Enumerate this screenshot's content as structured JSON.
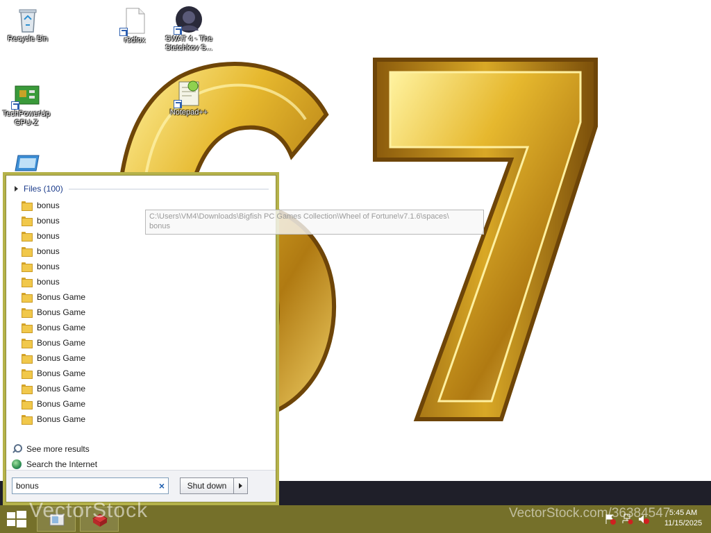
{
  "desktop": {
    "icons": [
      {
        "label": "Recycle Bin",
        "icon": "recycle-bin-icon"
      },
      {
        "label": "r3dfox",
        "icon": "file-shortcut-icon"
      },
      {
        "label": "SWAT 4 - The Stetchkov S...",
        "icon": "swat4-game-icon"
      },
      {
        "label": "TechPowerUp GPU-Z",
        "icon": "gpu-z-icon"
      },
      {
        "label": "Notepad++",
        "icon": "notepad-plus-plus-icon"
      }
    ],
    "wallpaper_text": "67"
  },
  "start_menu": {
    "group_header": "Files (100)",
    "results": [
      "bonus",
      "bonus",
      "bonus",
      "bonus",
      "bonus",
      "bonus",
      "Bonus Game",
      "Bonus Game",
      "Bonus Game",
      "Bonus Game",
      "Bonus Game",
      "Bonus Game",
      "Bonus Game",
      "Bonus Game",
      "Bonus Game"
    ],
    "see_more": "See more results",
    "search_internet": "Search the Internet",
    "search_value": "bonus",
    "shutdown_label": "Shut down"
  },
  "tooltip": {
    "line1": "C:\\Users\\VM4\\Downloads\\Bigfish PC Games Collection\\Wheel of Fortune\\v7.1.6\\spaces\\",
    "line2": "bonus"
  },
  "taskbar": {
    "time": "5:45 AM",
    "date": "11/15/2025",
    "watermark_left": "VectorStock",
    "watermark_right": "VectorStock.com/36384547"
  },
  "colors": {
    "taskbar": "#75702a",
    "start_frame": "#b5b24a",
    "link_blue": "#1a3a8a",
    "gold": "#d4a017"
  }
}
